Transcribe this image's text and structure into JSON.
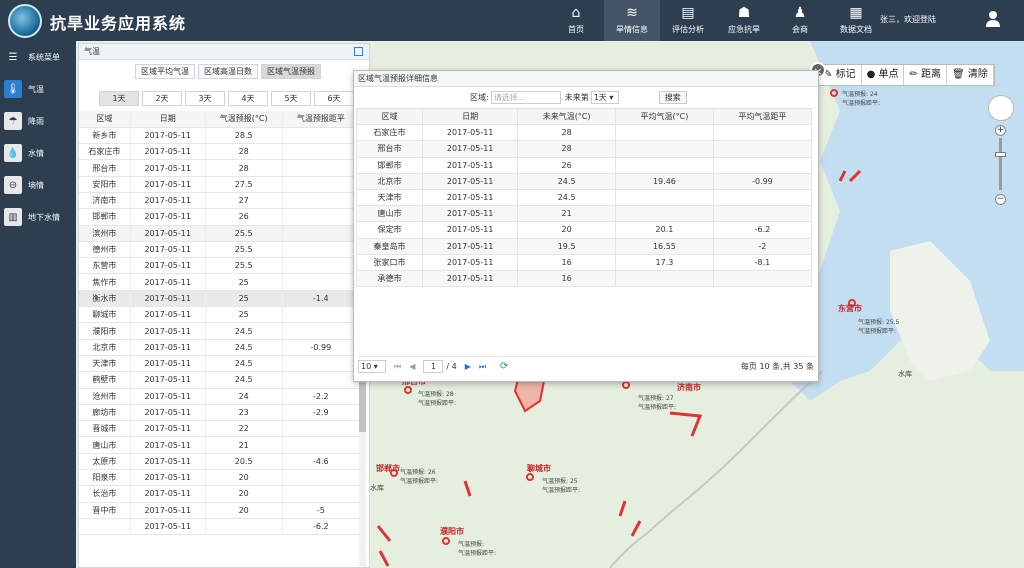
{
  "header": {
    "title": "抗旱业务应用系统",
    "nav": [
      "首页",
      "旱情信息",
      "评估分析",
      "应急抗旱",
      "会商",
      "数据文档"
    ],
    "active_nav": "旱情信息",
    "user_greeting": "张三，欢迎登陆"
  },
  "sidebar": {
    "items": [
      {
        "label": "系统菜单",
        "icon": "menu-icon"
      },
      {
        "label": "气温",
        "icon": "thermometer-icon",
        "active": true
      },
      {
        "label": "降雨",
        "icon": "rain-icon"
      },
      {
        "label": "水情",
        "icon": "water-drop-icon"
      },
      {
        "label": "墒情",
        "icon": "soil-icon"
      },
      {
        "label": "地下水情",
        "icon": "well-icon"
      }
    ]
  },
  "panel": {
    "title": "气温",
    "tabs": [
      "区域平均气温",
      "区域高温日数",
      "区域气温预报"
    ],
    "selected_tab": "区域气温预报",
    "days": [
      "1天",
      "2天",
      "3天",
      "4天",
      "5天",
      "6天"
    ],
    "selected_day": "1天",
    "columns": [
      "区域",
      "日期",
      "气温预报(°C)",
      "气温预报距平"
    ],
    "rows": [
      [
        "新乡市",
        "2017-05-11",
        "28.5",
        ""
      ],
      [
        "石家庄市",
        "2017-05-11",
        "28",
        ""
      ],
      [
        "邢台市",
        "2017-05-11",
        "28",
        ""
      ],
      [
        "安阳市",
        "2017-05-11",
        "27.5",
        ""
      ],
      [
        "济南市",
        "2017-05-11",
        "27",
        ""
      ],
      [
        "邯郸市",
        "2017-05-11",
        "26",
        ""
      ],
      [
        "滨州市",
        "2017-05-11",
        "25.5",
        ""
      ],
      [
        "德州市",
        "2017-05-11",
        "25.5",
        ""
      ],
      [
        "东营市",
        "2017-05-11",
        "25.5",
        ""
      ],
      [
        "焦作市",
        "2017-05-11",
        "25",
        ""
      ],
      [
        "衡水市",
        "2017-05-11",
        "25",
        "-1.4"
      ],
      [
        "聊城市",
        "2017-05-11",
        "25",
        ""
      ],
      [
        "濮阳市",
        "2017-05-11",
        "24.5",
        ""
      ],
      [
        "北京市",
        "2017-05-11",
        "24.5",
        "-0.99"
      ],
      [
        "天津市",
        "2017-05-11",
        "24.5",
        ""
      ],
      [
        "鹤壁市",
        "2017-05-11",
        "24.5",
        ""
      ],
      [
        "沧州市",
        "2017-05-11",
        "24",
        "-2.2"
      ],
      [
        "廊坊市",
        "2017-05-11",
        "23",
        "-2.9"
      ],
      [
        "晋城市",
        "2017-05-11",
        "22",
        ""
      ],
      [
        "唐山市",
        "2017-05-11",
        "21",
        ""
      ],
      [
        "太原市",
        "2017-05-11",
        "20.5",
        "-4.6"
      ],
      [
        "阳泉市",
        "2017-05-11",
        "20",
        ""
      ],
      [
        "长治市",
        "2017-05-11",
        "20",
        ""
      ],
      [
        "晋中市",
        "2017-05-11",
        "20",
        "-5"
      ],
      [
        "",
        "2017-05-11",
        "",
        "-6.2"
      ]
    ]
  },
  "dialog": {
    "title": "区域气温预报详细信息",
    "region_label": "区域:",
    "region_placeholder": "请选择...",
    "future_label": "未来第",
    "future_value": "1天",
    "search_label": "搜索",
    "columns": [
      "区域",
      "日期",
      "未来气温(°C)",
      "平均气温(°C)",
      "平均气温距平"
    ],
    "rows": [
      [
        "石家庄市",
        "2017-05-11",
        "28",
        "",
        ""
      ],
      [
        "邢台市",
        "2017-05-11",
        "28",
        "",
        ""
      ],
      [
        "邯郸市",
        "2017-05-11",
        "26",
        "",
        ""
      ],
      [
        "北京市",
        "2017-05-11",
        "24.5",
        "19.46",
        "-0.99"
      ],
      [
        "天津市",
        "2017-05-11",
        "24.5",
        "",
        ""
      ],
      [
        "唐山市",
        "2017-05-11",
        "21",
        "",
        ""
      ],
      [
        "保定市",
        "2017-05-11",
        "20",
        "20.1",
        "-6.2"
      ],
      [
        "秦皇岛市",
        "2017-05-11",
        "19.5",
        "16.55",
        "-2"
      ],
      [
        "张家口市",
        "2017-05-11",
        "16",
        "17.3",
        "-8.1"
      ],
      [
        "承德市",
        "2017-05-11",
        "16",
        "",
        ""
      ]
    ],
    "page_size": "10",
    "page_current": "1",
    "page_total": "/ 4",
    "page_info": "每页 10 条,共 35 条"
  },
  "map": {
    "tools": [
      "标记",
      "单点",
      "距离",
      "清除"
    ],
    "cities": [
      "东营市",
      "济南市",
      "聊城市",
      "邯郸市",
      "濮阳市",
      "邢台市"
    ],
    "popup_line1": "气温预报: ",
    "popup_line2": "气温预报距平:",
    "values": {
      "dongying": "25.5",
      "jinan": "27",
      "liaocheng": "25",
      "handan": "26",
      "xingtai": "28",
      "top": "24"
    },
    "reservoir": "水库"
  }
}
